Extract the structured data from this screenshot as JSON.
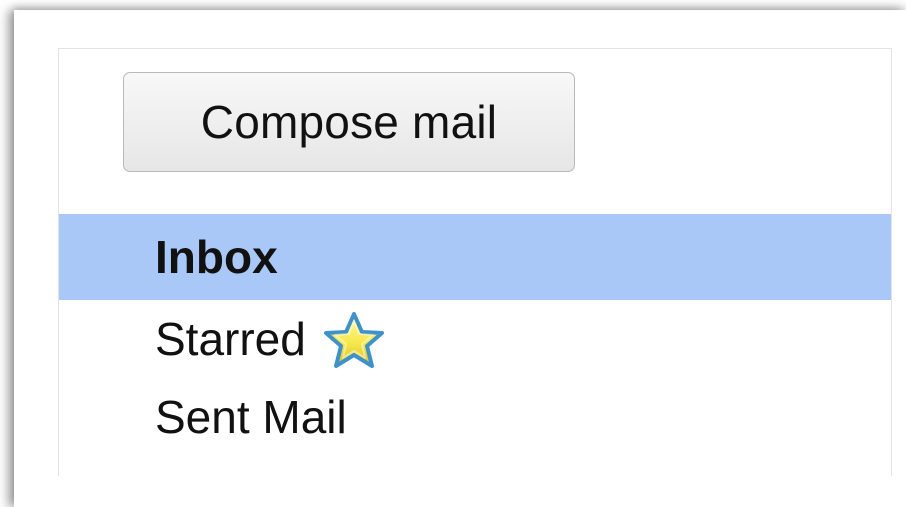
{
  "compose": {
    "label": "Compose mail"
  },
  "nav": {
    "items": [
      {
        "label": "Inbox",
        "selected": true
      },
      {
        "label": "Starred",
        "icon": "star-icon"
      },
      {
        "label": "Sent Mail"
      }
    ]
  },
  "colors": {
    "selected_background": "#a9c8f7",
    "star_fill": "#f6e84a",
    "star_outline": "#3f92c9"
  }
}
